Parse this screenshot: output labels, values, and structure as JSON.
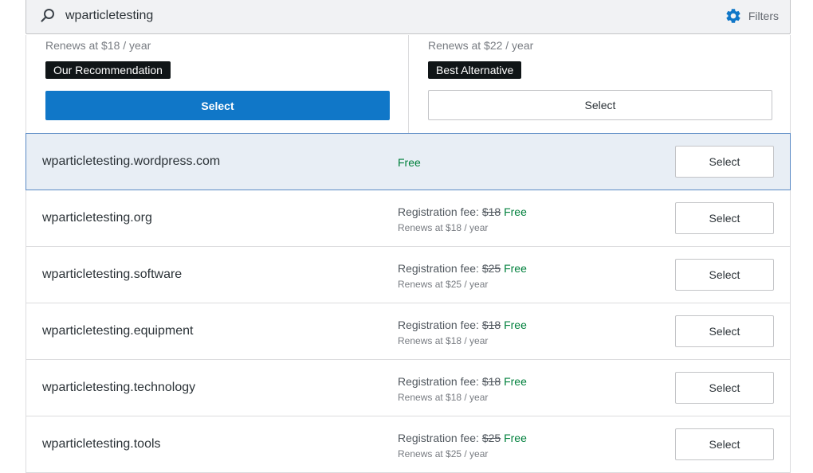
{
  "search": {
    "value": "wparticletesting",
    "filters_label": "Filters"
  },
  "recommendations": [
    {
      "renews": "Renews at $18 / year",
      "badge": "Our Recommendation",
      "button": "Select"
    },
    {
      "renews": "Renews at $22 / year",
      "badge": "Best Alternative",
      "button": "Select"
    }
  ],
  "results": [
    {
      "domain": "wparticletesting.wordpress.com",
      "fee_label": "",
      "old_price": "",
      "free": "Free",
      "renews": "",
      "button": "Select"
    },
    {
      "domain": "wparticletesting.org",
      "fee_label": "Registration fee: ",
      "old_price": "$18",
      "free": "Free",
      "renews": "Renews at $18 / year",
      "button": "Select"
    },
    {
      "domain": "wparticletesting.software",
      "fee_label": "Registration fee: ",
      "old_price": "$25",
      "free": "Free",
      "renews": "Renews at $25 / year",
      "button": "Select"
    },
    {
      "domain": "wparticletesting.equipment",
      "fee_label": "Registration fee: ",
      "old_price": "$18",
      "free": "Free",
      "renews": "Renews at $18 / year",
      "button": "Select"
    },
    {
      "domain": "wparticletesting.technology",
      "fee_label": "Registration fee: ",
      "old_price": "$18",
      "free": "Free",
      "renews": "Renews at $18 / year",
      "button": "Select"
    },
    {
      "domain": "wparticletesting.tools",
      "fee_label": "Registration fee: ",
      "old_price": "$25",
      "free": "Free",
      "renews": "Renews at $25 / year",
      "button": "Select"
    }
  ],
  "colors": {
    "primary": "#1077c8",
    "free": "#00803c",
    "highlight_bg": "#e8eef5",
    "badge_bg": "#101517"
  }
}
